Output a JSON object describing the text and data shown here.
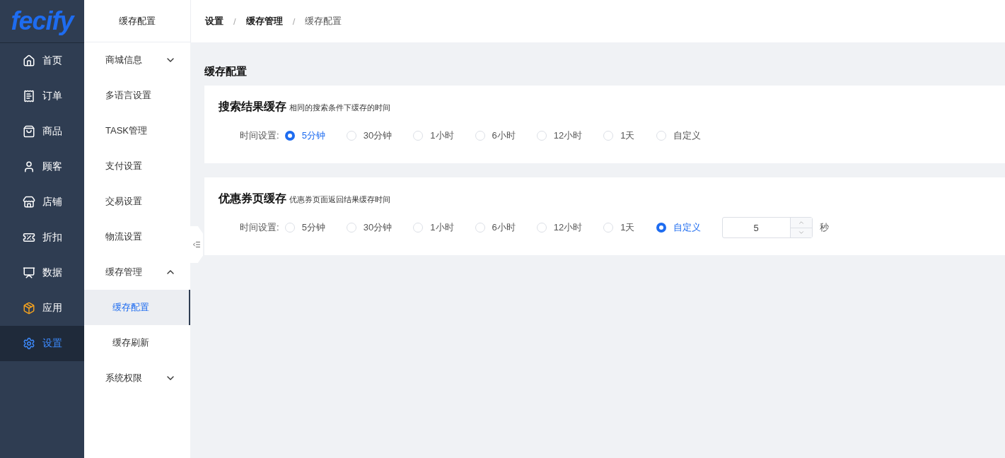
{
  "logo": "fecify",
  "nav": [
    {
      "label": "首页",
      "selected": false
    },
    {
      "label": "订单",
      "selected": false
    },
    {
      "label": "商品",
      "selected": false
    },
    {
      "label": "顾客",
      "selected": false
    },
    {
      "label": "店铺",
      "selected": false
    },
    {
      "label": "折扣",
      "selected": false
    },
    {
      "label": "数据",
      "selected": false
    },
    {
      "label": "应用",
      "selected": false
    },
    {
      "label": "设置",
      "selected": true
    }
  ],
  "submenu": {
    "title": "缓存配置",
    "items": [
      {
        "label": "商城信息",
        "expanded": false
      },
      {
        "label": "多语言设置"
      },
      {
        "label": "TASK管理"
      },
      {
        "label": "支付设置"
      },
      {
        "label": "交易设置"
      },
      {
        "label": "物流设置"
      },
      {
        "label": "缓存管理",
        "expanded": true,
        "children": [
          {
            "label": "缓存配置",
            "selected": true
          },
          {
            "label": "缓存刷新",
            "selected": false
          }
        ]
      },
      {
        "label": "系统权限",
        "expanded": false
      }
    ]
  },
  "breadcrumb": [
    "设置",
    "缓存管理",
    "缓存配置"
  ],
  "breadcrumb_separators": [
    "/",
    "/"
  ],
  "page_title": "缓存配置",
  "cards": [
    {
      "title": "搜索结果缓存",
      "hint": "相同的搜索条件下缓存的时间",
      "field_label": "时间设置:",
      "options": [
        {
          "label": "5分钟",
          "selected": true
        },
        {
          "label": "30分钟",
          "selected": false
        },
        {
          "label": "1小时",
          "selected": false
        },
        {
          "label": "6小时",
          "selected": false
        },
        {
          "label": "12小时",
          "selected": false
        },
        {
          "label": "1天",
          "selected": false
        },
        {
          "label": "自定义",
          "selected": false
        }
      ]
    },
    {
      "title": "优惠券页缓存",
      "hint": "优惠券页面返回结果缓存时间",
      "field_label": "时间设置:",
      "options": [
        {
          "label": "5分钟",
          "selected": false
        },
        {
          "label": "30分钟",
          "selected": false
        },
        {
          "label": "1小时",
          "selected": false
        },
        {
          "label": "6小时",
          "selected": false
        },
        {
          "label": "12小时",
          "selected": false
        },
        {
          "label": "1天",
          "selected": false
        },
        {
          "label": "自定义",
          "selected": true
        }
      ],
      "custom_value": "5",
      "unit": "秒"
    }
  ]
}
